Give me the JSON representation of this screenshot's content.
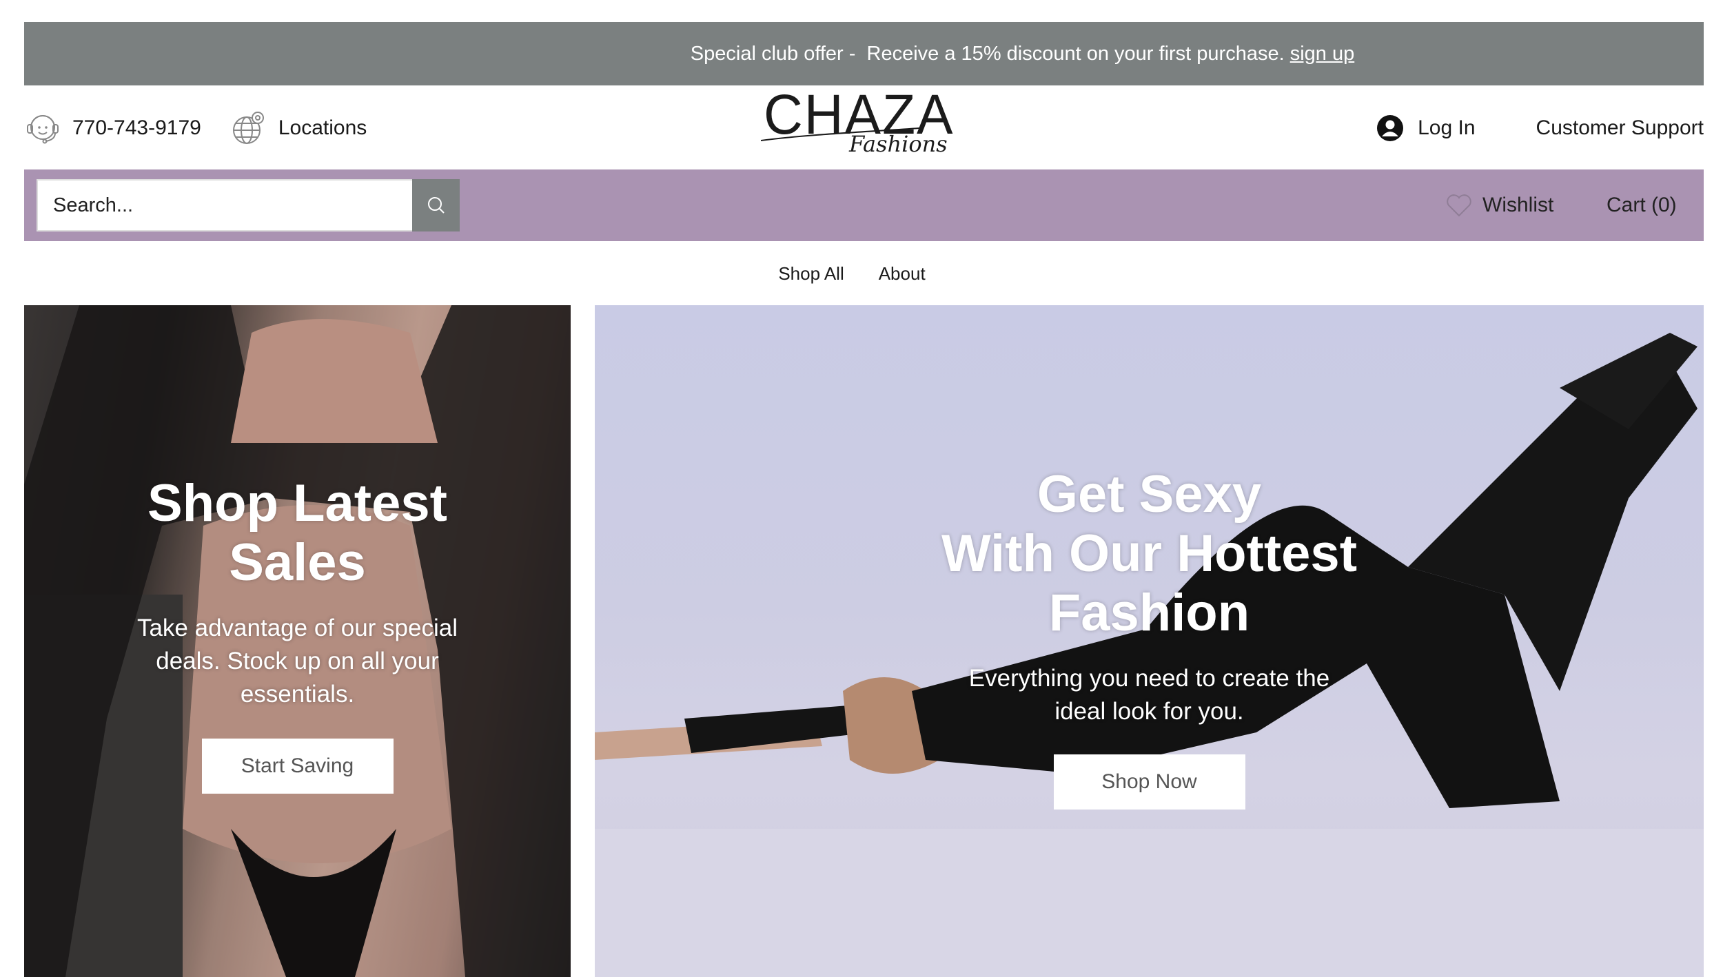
{
  "announcement": {
    "text": "Special club offer -  Receive a 15% discount on your first purchase. ",
    "link": "sign up"
  },
  "header": {
    "phone": "770-743-9179",
    "locations": "Locations",
    "logo_main": "CHAZA",
    "logo_sub": "Fashions",
    "login": "Log In",
    "support": "Customer Support"
  },
  "toolbar": {
    "search_placeholder": "Search...",
    "wishlist": "Wishlist",
    "cart": "Cart (0)"
  },
  "nav": {
    "items": [
      "Shop All",
      "About"
    ]
  },
  "hero_left": {
    "title": "Shop Latest\nSales",
    "body": "Take advantage of our special\ndeals. Stock up on all your\nessentials.",
    "cta": "Start Saving"
  },
  "hero_right": {
    "title": "Get Sexy\nWith Our Hottest\nFashion",
    "body": "Everything you need to create the\nideal look for you.",
    "cta": "Shop Now"
  },
  "colors": {
    "announcement_bg": "#7b8080",
    "toolbar_bg": "#aa93b2",
    "search_button_bg": "#7b8080"
  }
}
